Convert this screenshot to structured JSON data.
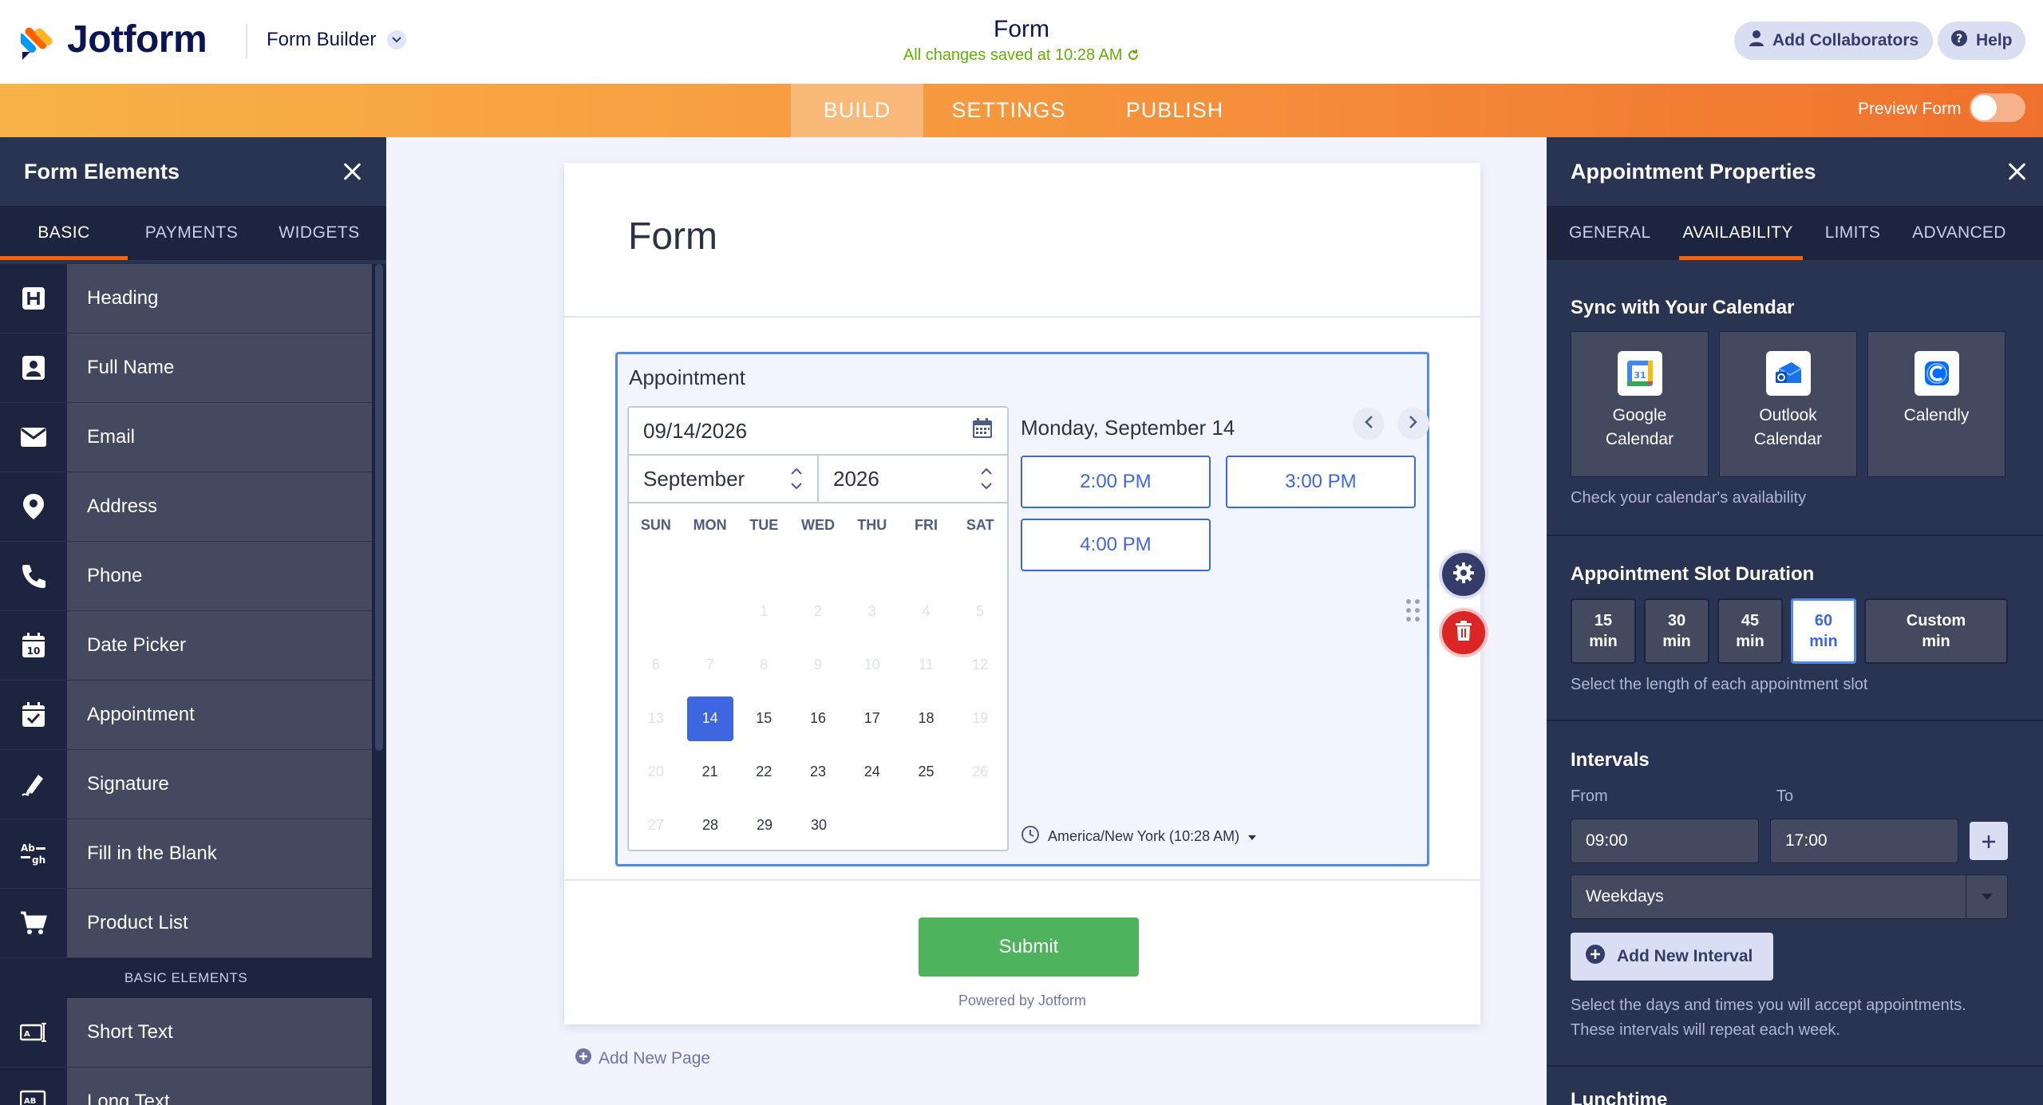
{
  "header": {
    "logo_text": "Jotform",
    "builder_menu": "Form Builder",
    "form_title": "Form",
    "save_status": "All changes saved at 10:28 AM",
    "add_collaborators": "Add Collaborators",
    "help": "Help"
  },
  "nav": {
    "tabs": [
      {
        "label": "BUILD"
      },
      {
        "label": "SETTINGS"
      },
      {
        "label": "PUBLISH"
      }
    ],
    "preview_label": "Preview Form"
  },
  "left_panel": {
    "title": "Form Elements",
    "tabs": [
      {
        "label": "BASIC"
      },
      {
        "label": "PAYMENTS"
      },
      {
        "label": "WIDGETS"
      }
    ],
    "items": [
      {
        "label": "Heading",
        "icon": "heading-icon"
      },
      {
        "label": "Full Name",
        "icon": "user-card-icon"
      },
      {
        "label": "Email",
        "icon": "envelope-icon"
      },
      {
        "label": "Address",
        "icon": "map-pin-icon"
      },
      {
        "label": "Phone",
        "icon": "phone-icon"
      },
      {
        "label": "Date Picker",
        "icon": "calendar-icon"
      },
      {
        "label": "Appointment",
        "icon": "calendar-check-icon"
      },
      {
        "label": "Signature",
        "icon": "pen-icon"
      },
      {
        "label": "Fill in the Blank",
        "icon": "fill-blank-icon"
      },
      {
        "label": "Product List",
        "icon": "cart-icon"
      }
    ],
    "section_label": "BASIC ELEMENTS",
    "items2": [
      {
        "label": "Short Text",
        "icon": "short-text-icon"
      },
      {
        "label": "Long Text",
        "icon": "long-text-icon"
      }
    ]
  },
  "form": {
    "heading": "Form",
    "appointment": {
      "label": "Appointment",
      "date_value": "09/14/2026",
      "month": "September",
      "year": "2026",
      "weekdays": [
        "SUN",
        "MON",
        "TUE",
        "WED",
        "THU",
        "FRI",
        "SAT"
      ],
      "selected_date_text": "Monday, September 14",
      "time_slots": [
        "2:00 PM",
        "3:00 PM",
        "4:00 PM"
      ],
      "timezone": "America/New York (10:28 AM)"
    },
    "submit_label": "Submit",
    "powered_by": "Powered by Jotform",
    "add_page": "Add New Page"
  },
  "right_panel": {
    "title": "Appointment Properties",
    "tabs": [
      {
        "label": "GENERAL"
      },
      {
        "label": "AVAILABILITY"
      },
      {
        "label": "LIMITS"
      },
      {
        "label": "ADVANCED"
      }
    ],
    "sync": {
      "heading": "Sync with Your Calendar",
      "cards": [
        {
          "line1": "Google",
          "line2": "Calendar"
        },
        {
          "line1": "Outlook",
          "line2": "Calendar"
        },
        {
          "line1": "Calendly",
          "line2": ""
        }
      ],
      "note": "Check your calendar's availability"
    },
    "duration": {
      "heading": "Appointment Slot Duration",
      "options": [
        {
          "value": "15",
          "unit": "min"
        },
        {
          "value": "30",
          "unit": "min"
        },
        {
          "value": "45",
          "unit": "min"
        },
        {
          "value": "60",
          "unit": "min"
        },
        {
          "value": "Custom",
          "unit": "min"
        }
      ],
      "note": "Select the length of each appointment slot"
    },
    "intervals": {
      "heading": "Intervals",
      "from_label": "From",
      "to_label": "To",
      "from_value": "09:00",
      "to_value": "17:00",
      "days_value": "Weekdays",
      "add_interval": "Add New Interval",
      "note_line1": "Select the days and times you will accept appointments.",
      "note_line2": "These intervals will repeat each week."
    },
    "lunchtime_heading": "Lunchtime"
  },
  "colors": {
    "accent_orange": "#ff6100",
    "selected_blue": "#3f66e1",
    "submit_green": "#4fb35e",
    "delete_red": "#dc2626"
  }
}
